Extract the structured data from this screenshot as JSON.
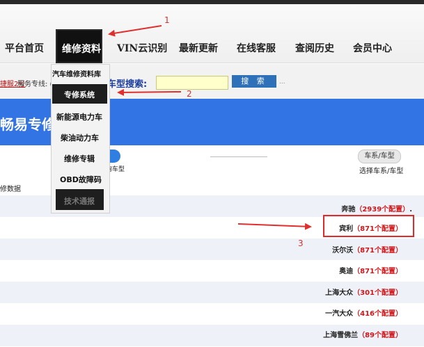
{
  "nav": {
    "items": [
      {
        "label": "平台首页"
      },
      {
        "label": "维修资料"
      },
      {
        "label": "VIN云识别"
      },
      {
        "label": "最新更新"
      },
      {
        "label": "在线客服"
      },
      {
        "label": "查阅历史"
      },
      {
        "label": "会员中心"
      }
    ]
  },
  "service": {
    "link": "捷服2号",
    "text": "服务专线: ("
  },
  "search": {
    "label": "车型搜索:",
    "value": "",
    "button": "搜 索",
    "dots": "..."
  },
  "dropdown": {
    "items": [
      "汽车维修资料库",
      "专修系统",
      "新能源电力车",
      "柴油动力车",
      "维修专辑",
      "OBD故障码",
      "技术通报"
    ]
  },
  "banner": {
    "title": "畅易专修"
  },
  "steps": {
    "step1_caption": "查询车型",
    "step2_button": "车系/车型",
    "step2_caption": "选择车系/车型",
    "repair_caption": "修数据"
  },
  "brands": [
    {
      "name": "奔驰",
      "count": "（2939个配置）",
      "suffix": "."
    },
    {
      "name": "宾利",
      "count": "（871个配置）",
      "suffix": ""
    },
    {
      "name": "沃尔沃",
      "count": "（871个配置）",
      "suffix": ""
    },
    {
      "name": "奥迪",
      "count": "（871个配置）",
      "suffix": ""
    },
    {
      "name": "上海大众",
      "count": "（301个配置）",
      "suffix": ""
    },
    {
      "name": "一汽大众",
      "count": "（416个配置）",
      "suffix": ""
    },
    {
      "name": "上海雪佛兰",
      "count": "（89个配置）",
      "suffix": ""
    }
  ],
  "annotations": {
    "one": "1",
    "two": "2",
    "three": "3"
  },
  "colors": {
    "banner_blue": "#3274e3",
    "arrow_red": "#e0302e",
    "count_red": "#d0161a",
    "nav_active": "#111111"
  }
}
